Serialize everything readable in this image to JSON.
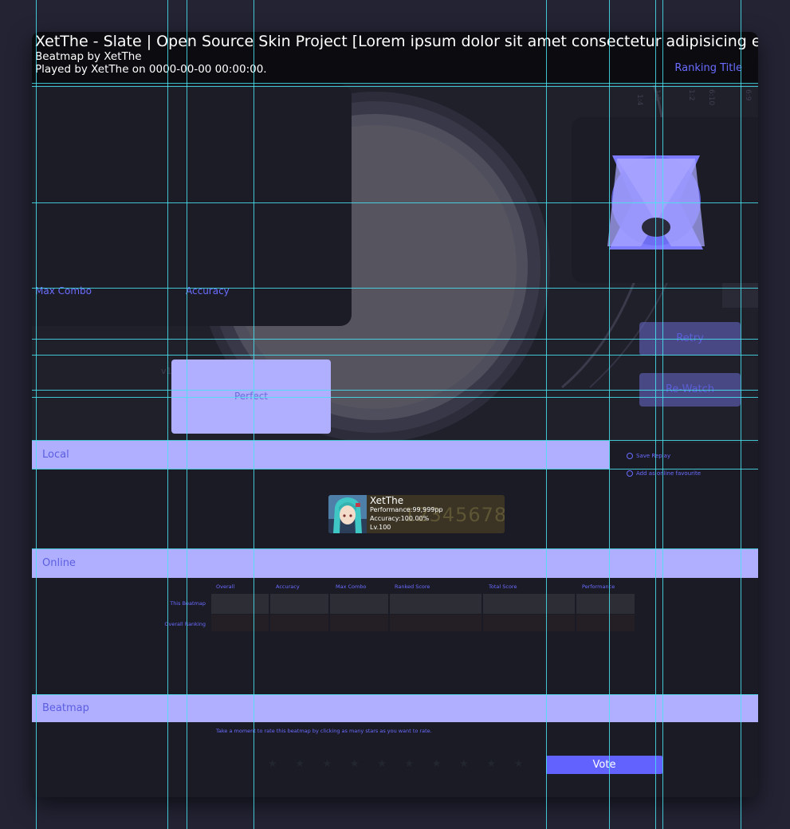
{
  "header": {
    "song_title": "XetThe - Slate | Open Source Skin Project [Lorem ipsum dolor sit amet consectetur adipisicing elit]",
    "mapper_line": "Beatmap by XetThe",
    "played_line": "Played by XetThe on 0000-00-00 00:00:00.",
    "ranking_title": "Ranking Title"
  },
  "stats": {
    "max_combo_label": "Max Combo",
    "accuracy_label": "Accuracy"
  },
  "version_text": "v1",
  "buttons": {
    "retry": "Retry",
    "rewatch": "Re-Watch",
    "vote": "Vote"
  },
  "judgement": {
    "label": "Perfect"
  },
  "sections": {
    "local": "Local",
    "online": "Online",
    "beatmap": "Beatmap"
  },
  "local_options": {
    "save_replay": "Save Replay",
    "add_favourite": "Add as online favourite"
  },
  "player": {
    "name": "XetThe",
    "performance": "Performance:99,999pp",
    "accuracy": "Accuracy:100.00%",
    "level": "Lv.100",
    "score": "12345678"
  },
  "ranking": {
    "columns": [
      "Overall",
      "Accuracy",
      "Max Combo",
      "Ranked Score",
      "Total Score",
      "Performance"
    ],
    "rows": [
      "This Beatmap",
      "Overall Ranking"
    ]
  },
  "beatmap": {
    "rate_prompt": "Take a moment to rate this beatmap by clicking as many stars as you want to rate.",
    "star_count": 10
  },
  "colors": {
    "accent": "#6a6cff",
    "section_bar": "#b0afff",
    "vote_button": "#6263ff",
    "panel": "#1c1c26",
    "guide": "#49e3f0"
  }
}
